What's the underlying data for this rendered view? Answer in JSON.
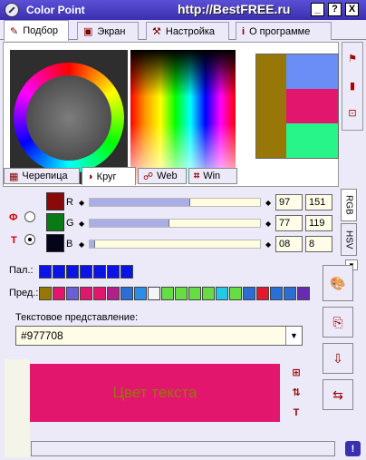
{
  "window": {
    "title": "Color Point",
    "watermark": "http://BestFREE.ru",
    "controls": {
      "minimize": "_",
      "help": "?",
      "close": "X"
    }
  },
  "tabs": [
    {
      "label": "Подбор",
      "icon": "pen-icon",
      "active": true
    },
    {
      "label": "Экран",
      "icon": "monitor-icon",
      "active": false
    },
    {
      "label": "Настройка",
      "icon": "tools-icon",
      "active": false
    },
    {
      "label": "О программе",
      "icon": "info-icon",
      "active": false
    }
  ],
  "picker_tabs": [
    {
      "label": "Черепица",
      "icon": "tile-icon",
      "active": false
    },
    {
      "label": "Круг",
      "icon": "circle-icon",
      "active": true
    },
    {
      "label": "Web",
      "icon": "web-icon",
      "active": false
    },
    {
      "label": "Win",
      "icon": "win-icon",
      "active": false
    }
  ],
  "swatches": {
    "main": "#977708",
    "variants": [
      "#6a8ef6",
      "#e3166d",
      "#27f58a"
    ]
  },
  "channels": {
    "phi_label": "Ф",
    "t_label": "Т",
    "rows": [
      {
        "label": "R",
        "value1": "97",
        "value2": "151",
        "fill": 0.59,
        "box_color": "#8a0a0a"
      },
      {
        "label": "G",
        "value1": "77",
        "value2": "119",
        "fill": 0.47,
        "box_color": "#0a7a14"
      },
      {
        "label": "B",
        "value1": "08",
        "value2": "8",
        "fill": 0.03,
        "box_color": "#05051a"
      }
    ],
    "mode_tabs": [
      "RGB",
      "HSV"
    ]
  },
  "palette": {
    "pal_label": "Пал.:",
    "pred_label": "Пред.:",
    "pal_colors": [
      "#0a14e6",
      "#0a14e6",
      "#0a14e6",
      "#0a14e6",
      "#0a14e6",
      "#0a14e6",
      "#0a14e6"
    ],
    "pred_colors": [
      "#977708",
      "#e3166d",
      "#6a5fd6",
      "#e3166d",
      "#e3166d",
      "#b0228a",
      "#2a6ed6",
      "#2a8ee6",
      "#f5f5f5",
      "#66dd44",
      "#66dd44",
      "#66dd44",
      "#66dd44",
      "#22c8e6",
      "#66dd44",
      "#2a6ed6",
      "#e31a2e",
      "#2a6ed6",
      "#2a6ed6",
      "#6a2ab0"
    ]
  },
  "text_representation": {
    "label": "Текстовое представление:",
    "value": "#977708"
  },
  "preview": {
    "text": "Цвет текста",
    "bg": "#e3166d",
    "fg": "#977708"
  }
}
